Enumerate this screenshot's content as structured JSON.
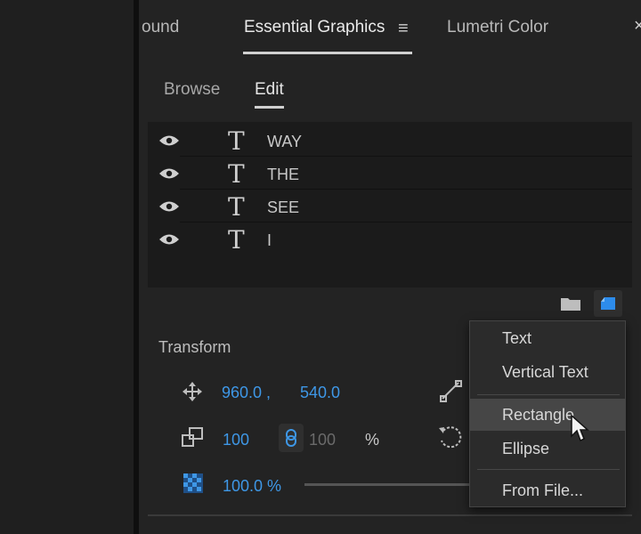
{
  "tabs": [
    {
      "label": "ound",
      "active": false
    },
    {
      "label": "Essential Graphics",
      "active": true
    },
    {
      "label": "Lumetri Color",
      "active": false
    }
  ],
  "panel_menu_icon": "hamburger-icon",
  "close_icon": "close-icon",
  "subtabs": [
    {
      "label": "Browse",
      "active": false
    },
    {
      "label": "Edit",
      "active": true
    }
  ],
  "layers": [
    {
      "name": "WAY",
      "icon": "text-layer-icon",
      "visible": true
    },
    {
      "name": "THE",
      "icon": "text-layer-icon",
      "visible": true
    },
    {
      "name": "SEE",
      "icon": "text-layer-icon",
      "visible": true
    },
    {
      "name": "I",
      "icon": "text-layer-icon",
      "visible": true
    }
  ],
  "toolbar": {
    "folder_icon": "folder-icon",
    "new_layer_icon": "new-layer-icon"
  },
  "transform": {
    "title": "Transform",
    "position_x": "960.0 ,",
    "position_y": "540.0",
    "scale": "100",
    "scale_height": "100",
    "scale_unit": "%",
    "opacity": "100.0 %"
  },
  "new_layer_menu": {
    "items": [
      "Text",
      "Vertical Text",
      "Rectangle",
      "Ellipse",
      "From File..."
    ],
    "hovered": "Rectangle"
  },
  "colors": {
    "accent_blue": "#3e97e6",
    "panel_bg": "#232323",
    "menu_bg": "#2b2b2b"
  }
}
